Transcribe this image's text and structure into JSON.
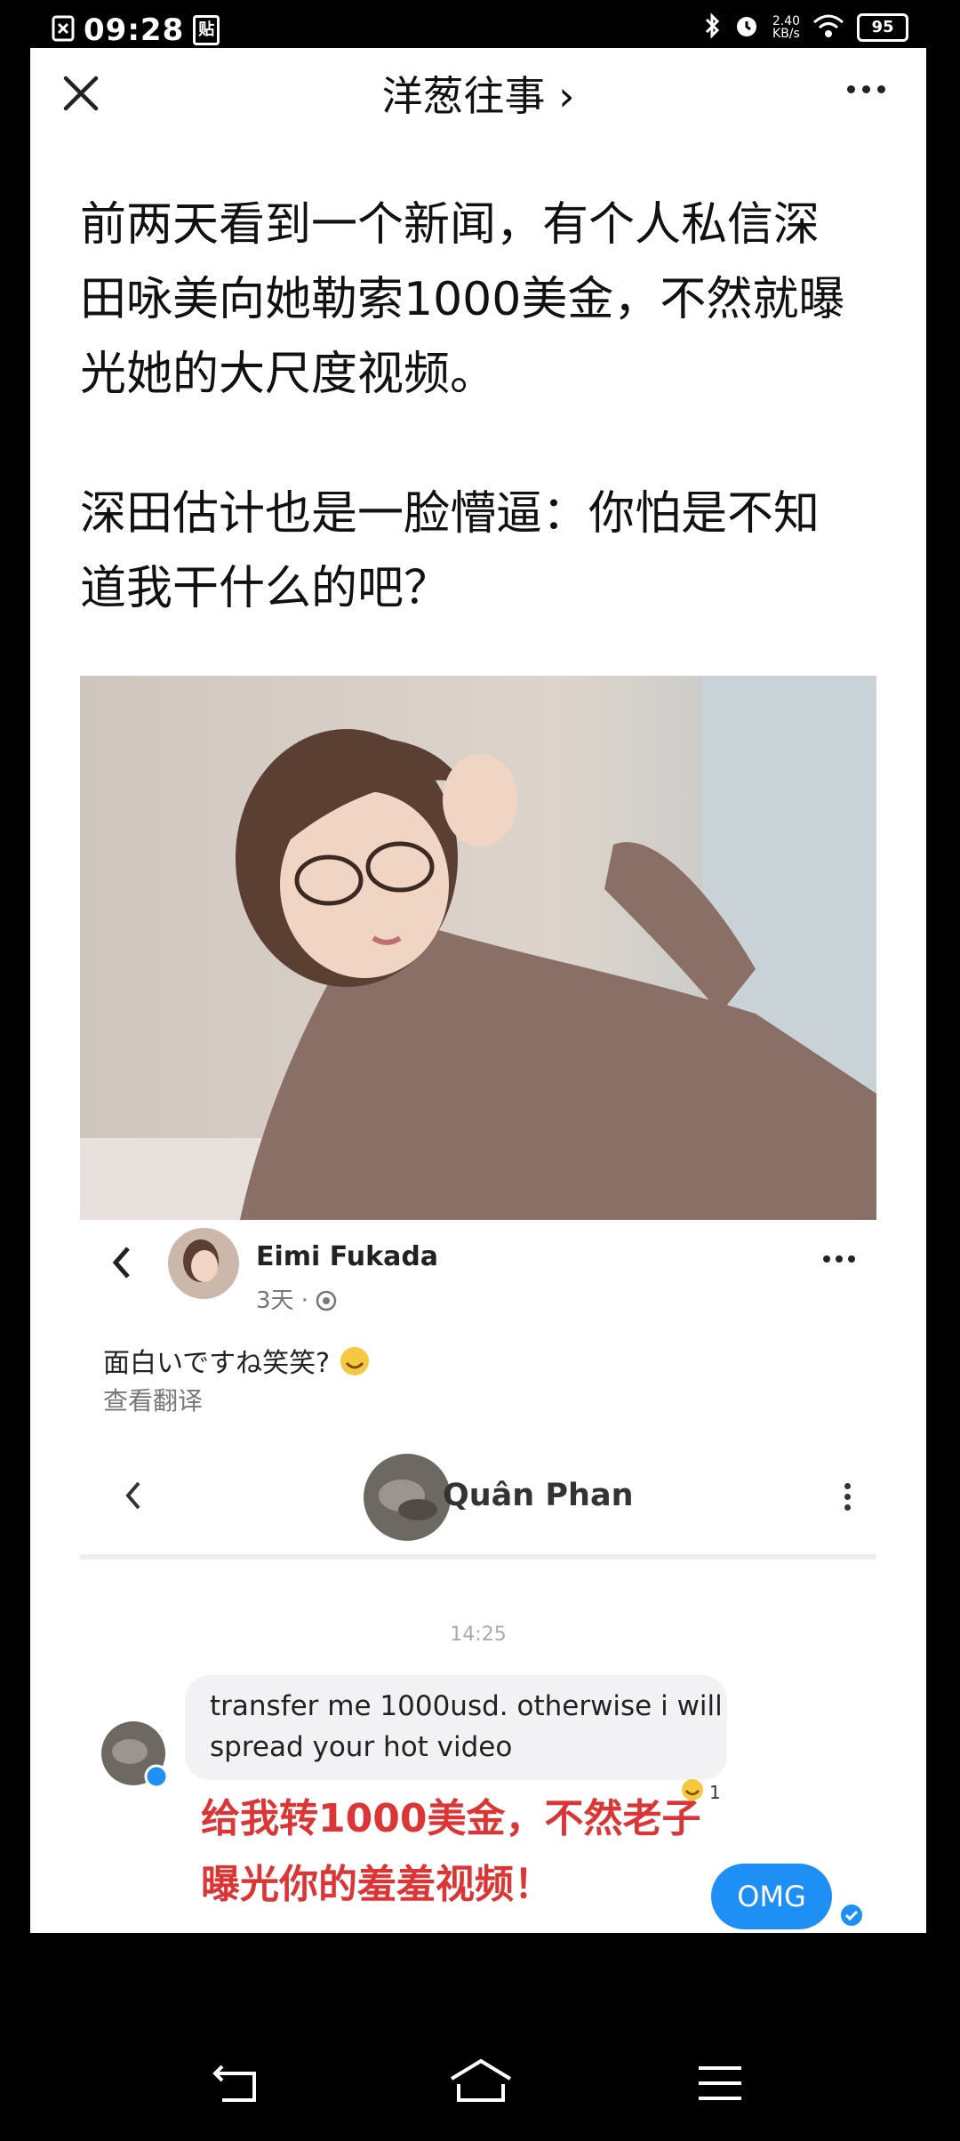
{
  "status_bar": {
    "time": "09:28",
    "left_badge": "贴",
    "net_speed_value": "2.40",
    "net_speed_unit": "KB/s",
    "battery": "95"
  },
  "header": {
    "title": "洋葱往事 ›"
  },
  "article": {
    "paragraphs": [
      [
        "前两天看到一个新闻，有个人私信深",
        "田咏美向她勒索1000美金，不然就曝",
        "光她的大尺度视频。"
      ],
      [
        "深田估计也是一脸懵逼：你怕是不知",
        "道我干什么的吧？"
      ]
    ]
  },
  "screenshot": {
    "fb_post": {
      "author": "Eimi Fukada",
      "time": "3天 ·",
      "text": "面白いですね笑笑?",
      "translate": "查看翻译"
    },
    "messenger": {
      "contact": "Quân Phan",
      "time": "14:25",
      "message": "transfer me 1000usd. otherwise i will spread your hot video",
      "reaction_count": "1",
      "translation_lines": [
        "给我转1000美金，不然老子",
        "曝光你的羞羞视频！"
      ],
      "reply": "OMG"
    }
  },
  "colors": {
    "red_text": "#dc3535",
    "messenger_blue": "#1e90f5"
  }
}
